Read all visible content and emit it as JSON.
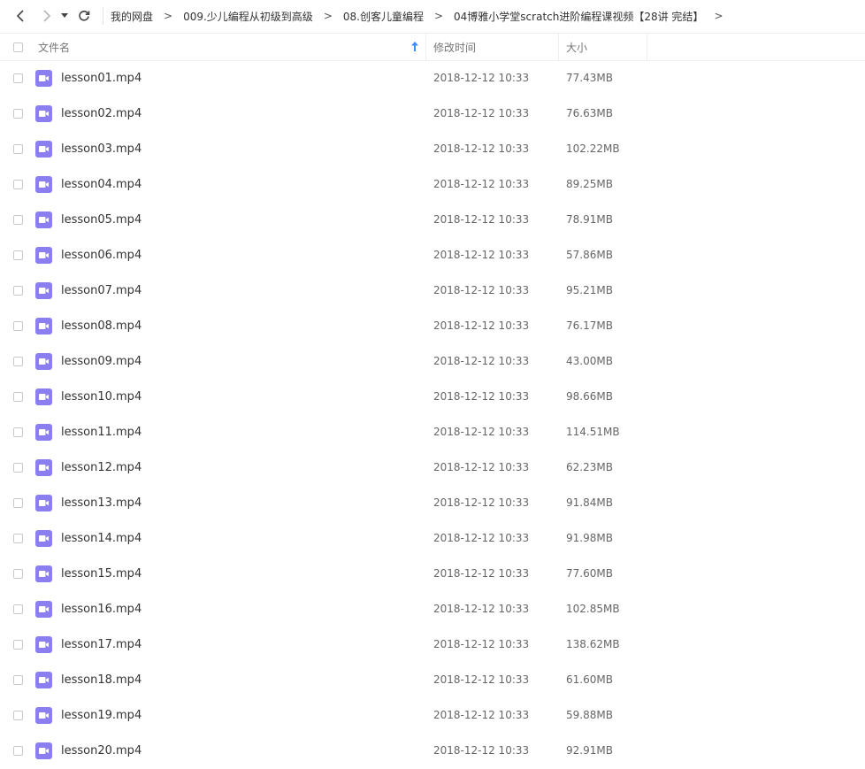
{
  "toolbar": {
    "back_icon": "chevron-left-icon",
    "forward_icon": "chevron-right-icon",
    "history_icon": "caret-down-icon",
    "refresh_icon": "refresh-icon"
  },
  "breadcrumb": {
    "separator": ">",
    "items": [
      "我的网盘",
      "009.少儿编程从初级到高级",
      "08.创客儿童编程",
      "04博雅小学堂scratch进阶编程课视频【28讲 完结】"
    ]
  },
  "columns": {
    "name": "文件名",
    "modified": "修改时间",
    "size": "大小",
    "sort_icon": "sort-ascending-icon"
  },
  "file_icon": "video-file-icon",
  "colors": {
    "video_icon": "#8b7ef0",
    "sort_arrow": "#3b8cff"
  },
  "files": [
    {
      "name": "lesson01.mp4",
      "modified": "2018-12-12 10:33",
      "size": "77.43MB"
    },
    {
      "name": "lesson02.mp4",
      "modified": "2018-12-12 10:33",
      "size": "76.63MB"
    },
    {
      "name": "lesson03.mp4",
      "modified": "2018-12-12 10:33",
      "size": "102.22MB"
    },
    {
      "name": "lesson04.mp4",
      "modified": "2018-12-12 10:33",
      "size": "89.25MB"
    },
    {
      "name": "lesson05.mp4",
      "modified": "2018-12-12 10:33",
      "size": "78.91MB"
    },
    {
      "name": "lesson06.mp4",
      "modified": "2018-12-12 10:33",
      "size": "57.86MB"
    },
    {
      "name": "lesson07.mp4",
      "modified": "2018-12-12 10:33",
      "size": "95.21MB"
    },
    {
      "name": "lesson08.mp4",
      "modified": "2018-12-12 10:33",
      "size": "76.17MB"
    },
    {
      "name": "lesson09.mp4",
      "modified": "2018-12-12 10:33",
      "size": "43.00MB"
    },
    {
      "name": "lesson10.mp4",
      "modified": "2018-12-12 10:33",
      "size": "98.66MB"
    },
    {
      "name": "lesson11.mp4",
      "modified": "2018-12-12 10:33",
      "size": "114.51MB"
    },
    {
      "name": "lesson12.mp4",
      "modified": "2018-12-12 10:33",
      "size": "62.23MB"
    },
    {
      "name": "lesson13.mp4",
      "modified": "2018-12-12 10:33",
      "size": "91.84MB"
    },
    {
      "name": "lesson14.mp4",
      "modified": "2018-12-12 10:33",
      "size": "91.98MB"
    },
    {
      "name": "lesson15.mp4",
      "modified": "2018-12-12 10:33",
      "size": "77.60MB"
    },
    {
      "name": "lesson16.mp4",
      "modified": "2018-12-12 10:33",
      "size": "102.85MB"
    },
    {
      "name": "lesson17.mp4",
      "modified": "2018-12-12 10:33",
      "size": "138.62MB"
    },
    {
      "name": "lesson18.mp4",
      "modified": "2018-12-12 10:33",
      "size": "61.60MB"
    },
    {
      "name": "lesson19.mp4",
      "modified": "2018-12-12 10:33",
      "size": "59.88MB"
    },
    {
      "name": "lesson20.mp4",
      "modified": "2018-12-12 10:33",
      "size": "92.91MB"
    }
  ]
}
